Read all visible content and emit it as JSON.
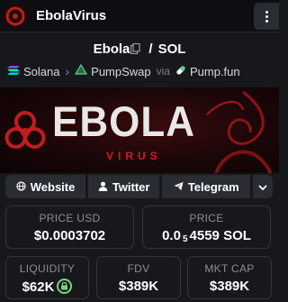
{
  "header": {
    "title": "EbolaVirus"
  },
  "pair": {
    "base": "Ebola",
    "separator": "/",
    "quote": "SOL"
  },
  "route": {
    "chain": "Solana",
    "dex": "PumpSwap",
    "via_label": "via",
    "launchpad": "Pump.fun"
  },
  "banner": {
    "word": "EBOLA",
    "subword": "VIRUS"
  },
  "links": {
    "website": "Website",
    "twitter": "Twitter",
    "telegram": "Telegram"
  },
  "stats": {
    "price_usd": {
      "label": "PRICE USD",
      "value": "$0.0003702"
    },
    "price_sol": {
      "label": "PRICE",
      "prefix": "0.0",
      "zeros": "5",
      "digits": "4559",
      "unit": "SOL"
    },
    "liquidity": {
      "label": "LIQUIDITY",
      "value": "$62K"
    },
    "fdv": {
      "label": "FDV",
      "value": "$389K"
    },
    "mkt_cap": {
      "label": "MKT CAP",
      "value": "$389K"
    }
  },
  "colors": {
    "background": "#17181c",
    "card_border": "#34353b",
    "button": "#2a2c33",
    "accent_red": "#d21d22",
    "lock_green": "#7bd37b"
  },
  "icons": [
    "biohazard-icon",
    "copy-icon",
    "solana-icon",
    "pumpswap-icon",
    "pill-icon",
    "globe-icon",
    "user-icon",
    "paper-plane-icon",
    "chevron-down-icon",
    "lock-icon",
    "kebab-menu-icon"
  ]
}
